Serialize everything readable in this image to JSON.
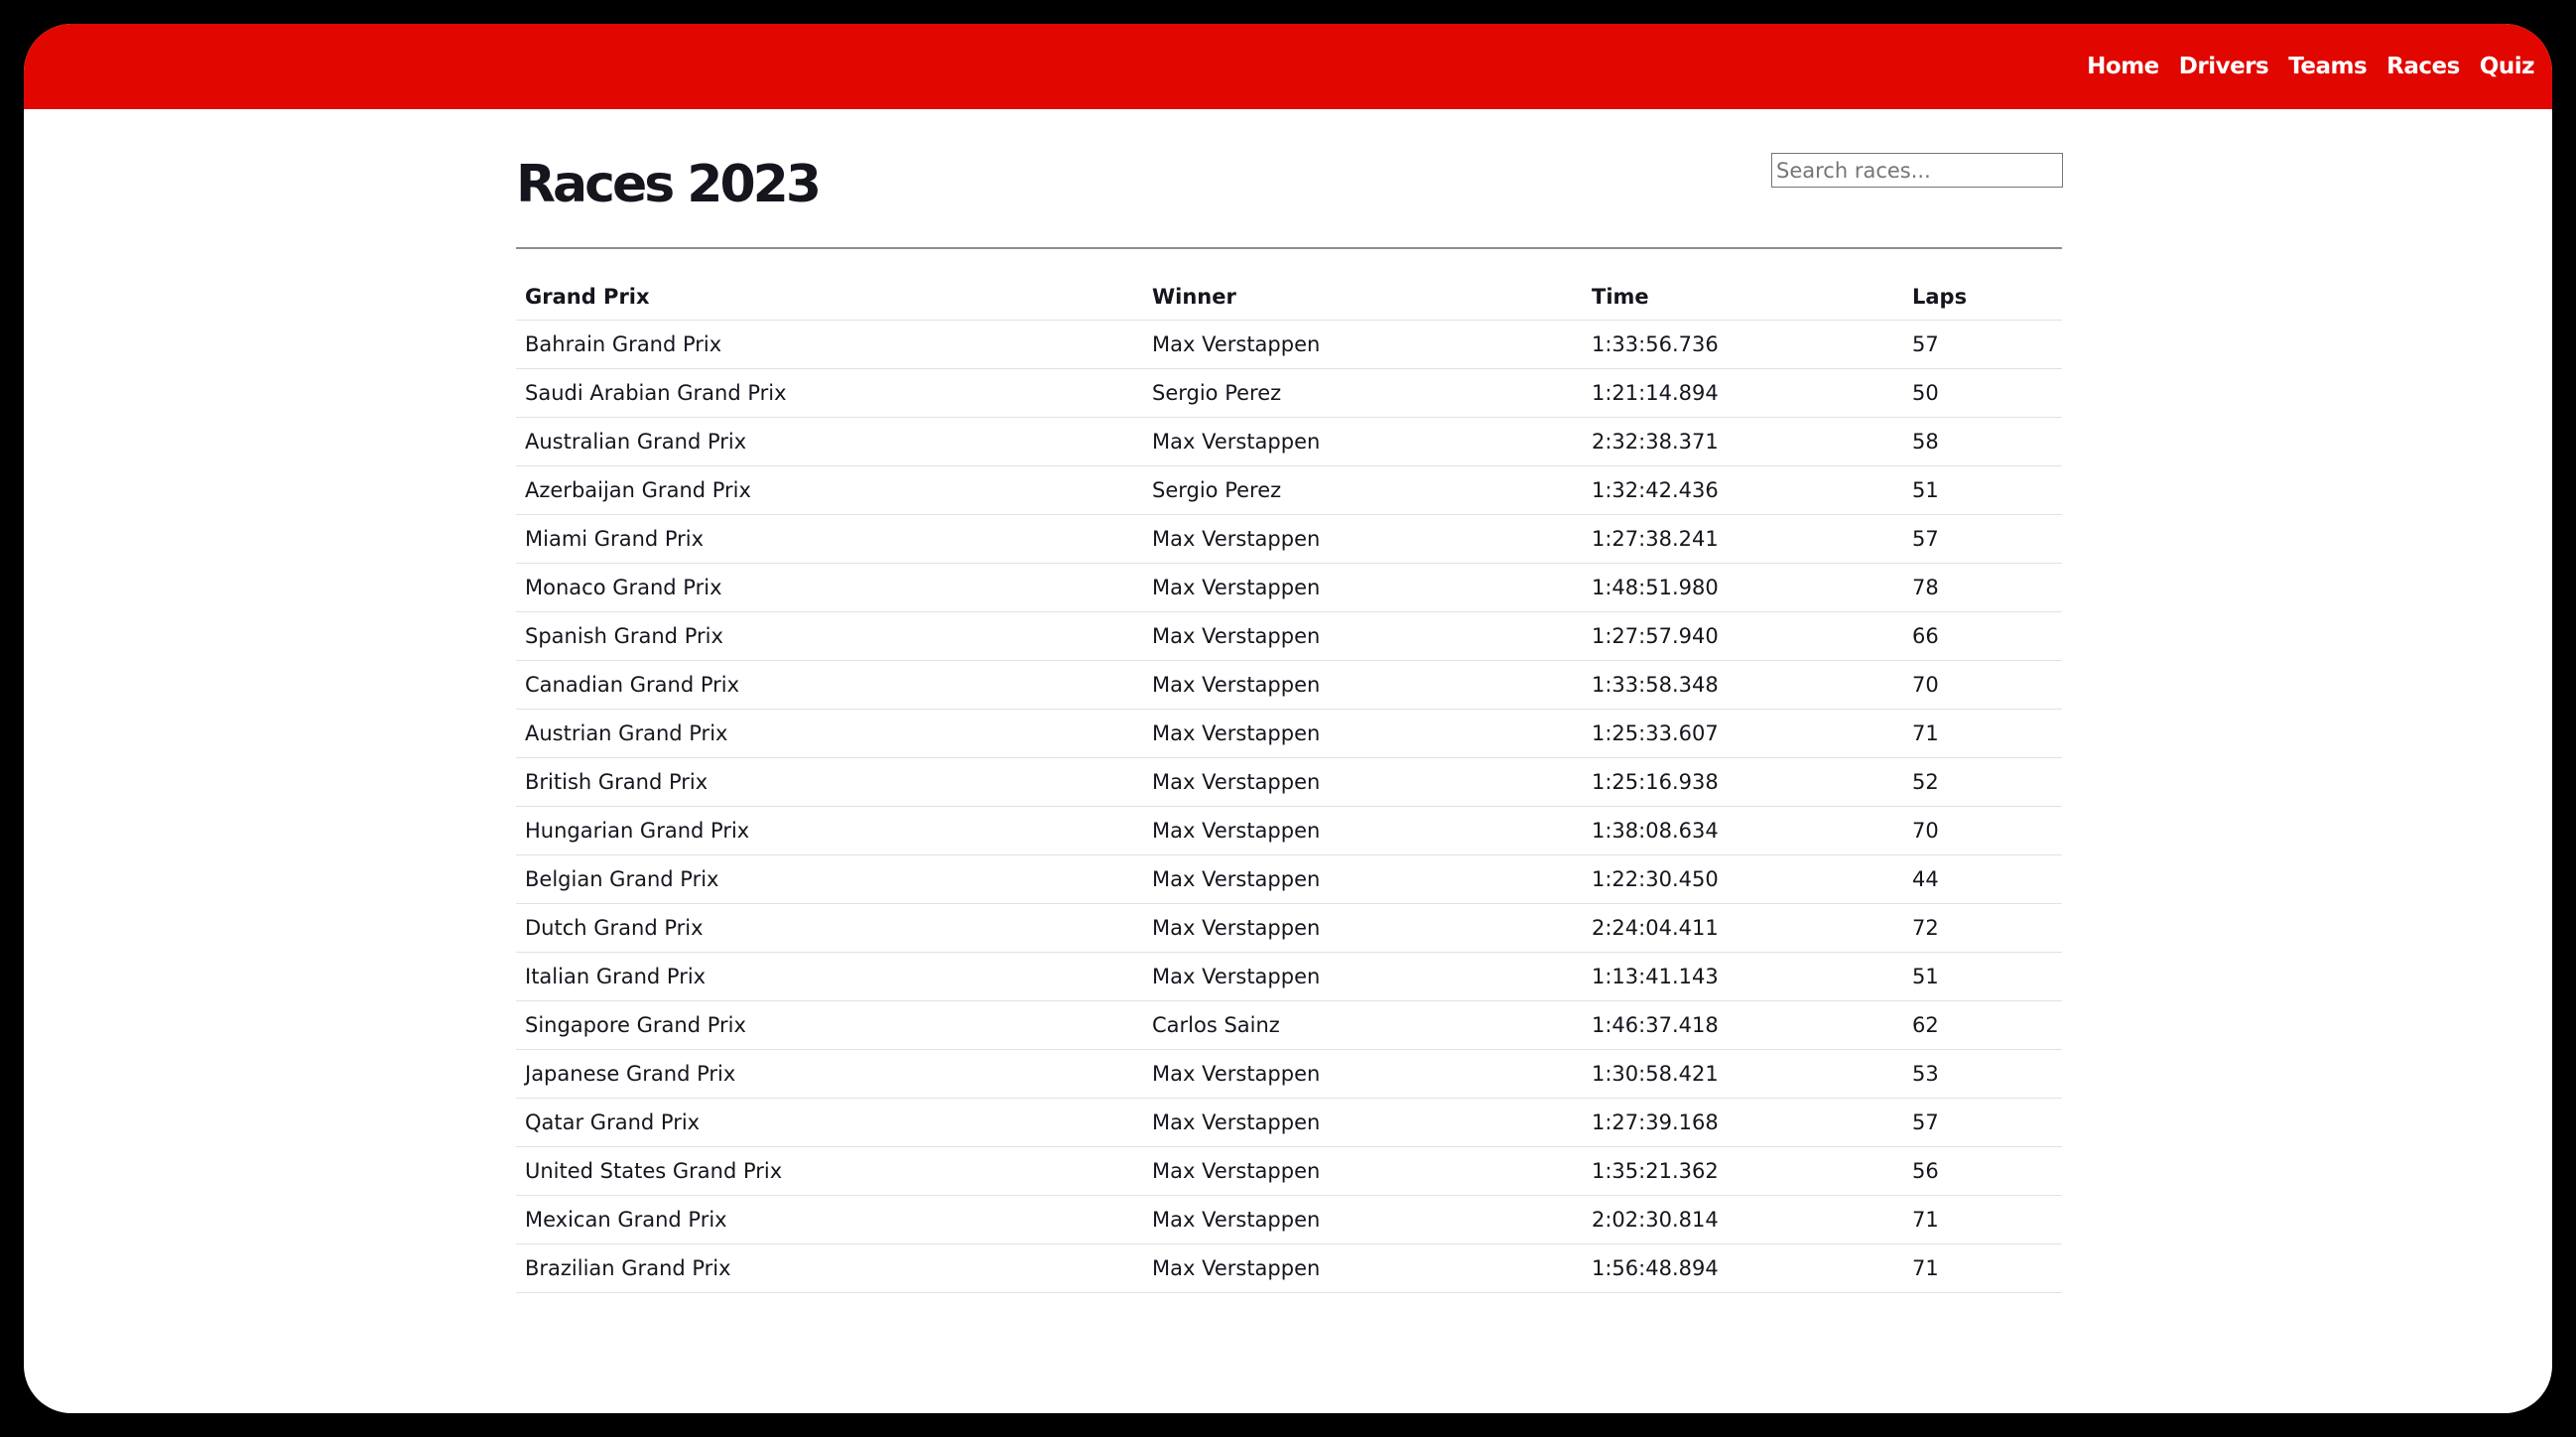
{
  "nav": {
    "items": [
      "Home",
      "Drivers",
      "Teams",
      "Races",
      "Quiz"
    ]
  },
  "page": {
    "title": "Races 2023"
  },
  "search": {
    "placeholder": "Search races..."
  },
  "table": {
    "headers": {
      "grand_prix": "Grand Prix",
      "winner": "Winner",
      "time": "Time",
      "laps": "Laps"
    },
    "rows": [
      {
        "grand_prix": "Bahrain Grand Prix",
        "winner": "Max Verstappen",
        "time": "1:33:56.736",
        "laps": "57"
      },
      {
        "grand_prix": "Saudi Arabian Grand Prix",
        "winner": "Sergio Perez",
        "time": "1:21:14.894",
        "laps": "50"
      },
      {
        "grand_prix": "Australian Grand Prix",
        "winner": "Max Verstappen",
        "time": "2:32:38.371",
        "laps": "58"
      },
      {
        "grand_prix": "Azerbaijan Grand Prix",
        "winner": "Sergio Perez",
        "time": "1:32:42.436",
        "laps": "51"
      },
      {
        "grand_prix": "Miami Grand Prix",
        "winner": "Max Verstappen",
        "time": "1:27:38.241",
        "laps": "57"
      },
      {
        "grand_prix": "Monaco Grand Prix",
        "winner": "Max Verstappen",
        "time": "1:48:51.980",
        "laps": "78"
      },
      {
        "grand_prix": "Spanish Grand Prix",
        "winner": "Max Verstappen",
        "time": "1:27:57.940",
        "laps": "66"
      },
      {
        "grand_prix": "Canadian Grand Prix",
        "winner": "Max Verstappen",
        "time": "1:33:58.348",
        "laps": "70"
      },
      {
        "grand_prix": "Austrian Grand Prix",
        "winner": "Max Verstappen",
        "time": "1:25:33.607",
        "laps": "71"
      },
      {
        "grand_prix": "British Grand Prix",
        "winner": "Max Verstappen",
        "time": "1:25:16.938",
        "laps": "52"
      },
      {
        "grand_prix": "Hungarian Grand Prix",
        "winner": "Max Verstappen",
        "time": "1:38:08.634",
        "laps": "70"
      },
      {
        "grand_prix": "Belgian Grand Prix",
        "winner": "Max Verstappen",
        "time": "1:22:30.450",
        "laps": "44"
      },
      {
        "grand_prix": "Dutch Grand Prix",
        "winner": "Max Verstappen",
        "time": "2:24:04.411",
        "laps": "72"
      },
      {
        "grand_prix": "Italian Grand Prix",
        "winner": "Max Verstappen",
        "time": "1:13:41.143",
        "laps": "51"
      },
      {
        "grand_prix": "Singapore Grand Prix",
        "winner": "Carlos Sainz",
        "time": "1:46:37.418",
        "laps": "62"
      },
      {
        "grand_prix": "Japanese Grand Prix",
        "winner": "Max Verstappen",
        "time": "1:30:58.421",
        "laps": "53"
      },
      {
        "grand_prix": "Qatar Grand Prix",
        "winner": "Max Verstappen",
        "time": "1:27:39.168",
        "laps": "57"
      },
      {
        "grand_prix": "United States Grand Prix",
        "winner": "Max Verstappen",
        "time": "1:35:21.362",
        "laps": "56"
      },
      {
        "grand_prix": "Mexican Grand Prix",
        "winner": "Max Verstappen",
        "time": "2:02:30.814",
        "laps": "71"
      },
      {
        "grand_prix": "Brazilian Grand Prix",
        "winner": "Max Verstappen",
        "time": "1:56:48.894",
        "laps": "71"
      }
    ]
  },
  "colors": {
    "brand_red": "#e10600",
    "text": "#15151e",
    "background": "#ffffff"
  }
}
